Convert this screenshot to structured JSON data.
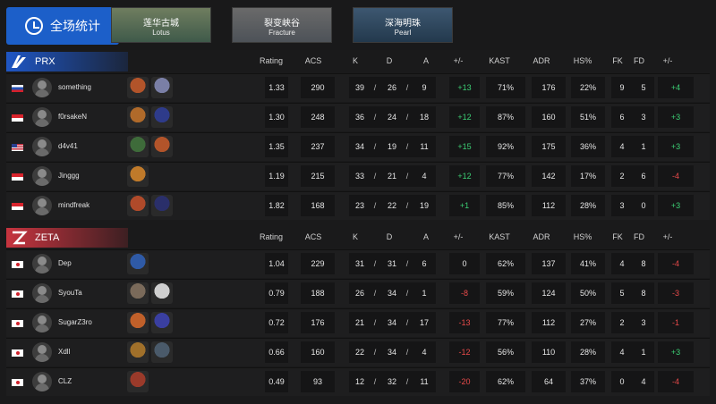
{
  "overall_label": "全场统计",
  "maps": [
    {
      "zh": "莲华古城",
      "en": "Lotus",
      "c1": "#3f5a4a",
      "c2": "#6f7d5f"
    },
    {
      "zh": "裂变峡谷",
      "en": "Fracture",
      "c1": "#4d5258",
      "c2": "#6a6a6a"
    },
    {
      "zh": "深海明珠",
      "en": "Pearl",
      "c1": "#23394d",
      "c2": "#3d5770"
    }
  ],
  "columns": [
    "Rating",
    "ACS",
    "K",
    "D",
    "A",
    "+/-",
    "KAST",
    "ADR",
    "HS%",
    "FK",
    "FD",
    "+/-"
  ],
  "teams": [
    {
      "name": "PRX",
      "accent": "#1f56c4",
      "players": [
        {
          "flag": "ru",
          "name": "something",
          "agents": [
            "#b2542a",
            "#7a7fa6"
          ],
          "rating": "1.33",
          "acs": "290",
          "k": "39",
          "d": "26",
          "a": "9",
          "diff": "+13",
          "kast": "71%",
          "adr": "176",
          "hs": "22%",
          "fk": "9",
          "fd": "5",
          "fdiff": "+4"
        },
        {
          "flag": "id",
          "name": "f0rsakeN",
          "agents": [
            "#b06a2a",
            "#2e3b8a"
          ],
          "rating": "1.30",
          "acs": "248",
          "k": "36",
          "d": "24",
          "a": "18",
          "diff": "+12",
          "kast": "87%",
          "adr": "160",
          "hs": "51%",
          "fk": "6",
          "fd": "3",
          "fdiff": "+3"
        },
        {
          "flag": "us",
          "name": "d4v41",
          "agents": [
            "#3e6b3a",
            "#b2542a"
          ],
          "rating": "1.35",
          "acs": "237",
          "k": "34",
          "d": "19",
          "a": "11",
          "diff": "+15",
          "kast": "92%",
          "adr": "175",
          "hs": "36%",
          "fk": "4",
          "fd": "1",
          "fdiff": "+3"
        },
        {
          "flag": "id",
          "name": "Jinggg",
          "agents": [
            "#c07a2a"
          ],
          "rating": "1.19",
          "acs": "215",
          "k": "33",
          "d": "21",
          "a": "4",
          "diff": "+12",
          "kast": "77%",
          "adr": "142",
          "hs": "17%",
          "fk": "2",
          "fd": "6",
          "fdiff": "-4"
        },
        {
          "flag": "id",
          "name": "mindfreak",
          "agents": [
            "#b04a2a",
            "#2a2f6a"
          ],
          "rating": "1.82",
          "acs": "168",
          "k": "23",
          "d": "22",
          "a": "19",
          "diff": "+1",
          "kast": "85%",
          "adr": "112",
          "hs": "28%",
          "fk": "3",
          "fd": "0",
          "fdiff": "+3"
        }
      ]
    },
    {
      "name": "ZETA",
      "accent": "#c7343f",
      "players": [
        {
          "flag": "jp",
          "name": "Dep",
          "agents": [
            "#2f5aa6"
          ],
          "rating": "1.04",
          "acs": "229",
          "k": "31",
          "d": "31",
          "a": "6",
          "diff": "0",
          "kast": "62%",
          "adr": "137",
          "hs": "41%",
          "fk": "4",
          "fd": "8",
          "fdiff": "-4"
        },
        {
          "flag": "jp",
          "name": "SyouTa",
          "agents": [
            "#7a6a5a",
            "#cfcfcf"
          ],
          "rating": "0.79",
          "acs": "188",
          "k": "26",
          "d": "34",
          "a": "1",
          "diff": "-8",
          "kast": "59%",
          "adr": "124",
          "hs": "50%",
          "fk": "5",
          "fd": "8",
          "fdiff": "-3"
        },
        {
          "flag": "jp",
          "name": "SugarZ3ro",
          "agents": [
            "#c0602a",
            "#3a3fa0"
          ],
          "rating": "0.72",
          "acs": "176",
          "k": "21",
          "d": "34",
          "a": "17",
          "diff": "-13",
          "kast": "77%",
          "adr": "112",
          "hs": "27%",
          "fk": "2",
          "fd": "3",
          "fdiff": "-1"
        },
        {
          "flag": "jp",
          "name": "Xdll",
          "agents": [
            "#a0702a",
            "#4a5a6a"
          ],
          "rating": "0.66",
          "acs": "160",
          "k": "22",
          "d": "34",
          "a": "4",
          "diff": "-12",
          "kast": "56%",
          "adr": "110",
          "hs": "28%",
          "fk": "4",
          "fd": "1",
          "fdiff": "+3"
        },
        {
          "flag": "jp",
          "name": "CLZ",
          "agents": [
            "#9a3a2a"
          ],
          "rating": "0.49",
          "acs": "93",
          "k": "12",
          "d": "32",
          "a": "11",
          "diff": "-20",
          "kast": "62%",
          "adr": "64",
          "hs": "37%",
          "fk": "0",
          "fd": "4",
          "fdiff": "-4"
        }
      ]
    }
  ]
}
